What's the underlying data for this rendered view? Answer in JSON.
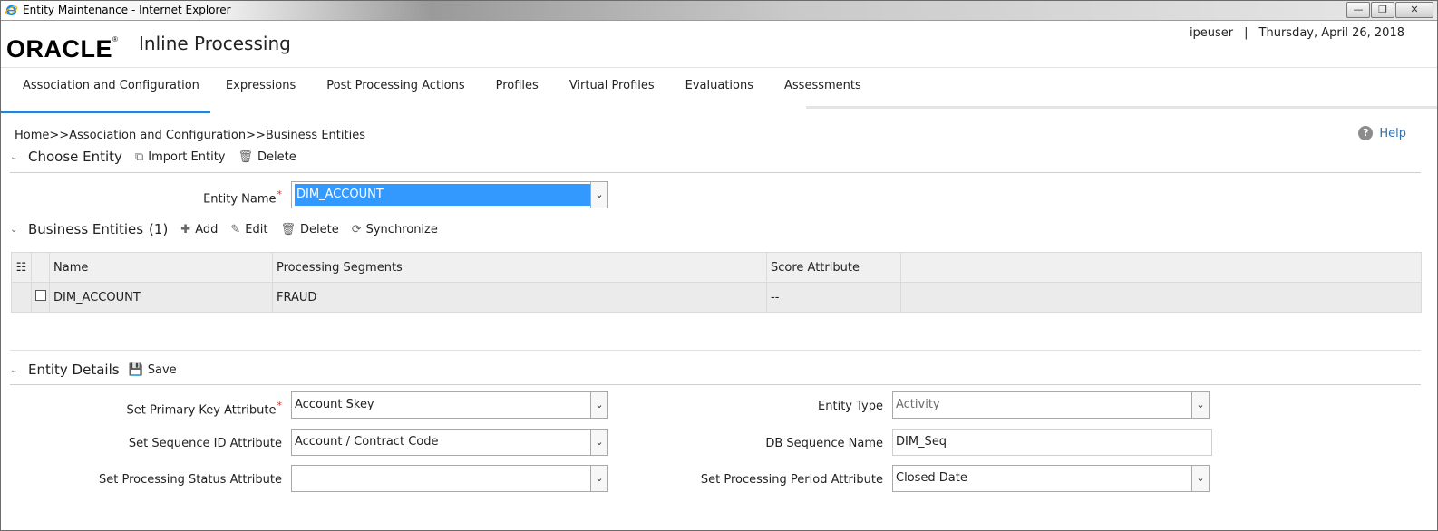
{
  "window": {
    "title": "Entity Maintenance - Internet Explorer"
  },
  "header": {
    "logo": "ORACLE",
    "app_name": "Inline Processing",
    "user": "ipeuser",
    "separator": "|",
    "date": "Thursday, April 26, 2018"
  },
  "nav": {
    "tabs": [
      {
        "label": "Association and Configuration"
      },
      {
        "label": "Expressions"
      },
      {
        "label": "Post Processing Actions"
      },
      {
        "label": "Profiles"
      },
      {
        "label": "Virtual Profiles"
      },
      {
        "label": "Evaluations"
      },
      {
        "label": "Assessments"
      }
    ]
  },
  "breadcrumb": "Home>>Association and Configuration>>Business Entities",
  "help": {
    "label": "Help"
  },
  "choose_entity": {
    "title": "Choose Entity",
    "import_label": "Import Entity",
    "delete_label": "Delete",
    "entity_name_label": "Entity Name",
    "entity_name_value": "DIM_ACCOUNT"
  },
  "business_entities": {
    "title": "Business Entities",
    "count": "(1)",
    "add_label": "Add",
    "edit_label": "Edit",
    "delete_label": "Delete",
    "sync_label": "Synchronize",
    "columns": [
      "Name",
      "Processing Segments",
      "Score Attribute"
    ],
    "rows": [
      {
        "name": "DIM_ACCOUNT",
        "segments": "FRAUD",
        "score": "--"
      }
    ]
  },
  "entity_details": {
    "title": "Entity Details",
    "save_label": "Save",
    "primary_key_label": "Set Primary Key Attribute",
    "primary_key_value": "Account Skey",
    "sequence_id_label": "Set Sequence ID Attribute",
    "sequence_id_value": "Account / Contract Code",
    "status_label": "Set Processing Status Attribute",
    "status_value": "",
    "entity_type_label": "Entity Type",
    "entity_type_value": "Activity",
    "db_seq_label": "DB Sequence Name",
    "db_seq_value": "DIM_Seq",
    "period_label": "Set Processing Period Attribute",
    "period_value": "Closed Date"
  },
  "colors": {
    "accent": "#2f80c6",
    "highlight": "#3399ff",
    "link": "#2f6fb0"
  }
}
